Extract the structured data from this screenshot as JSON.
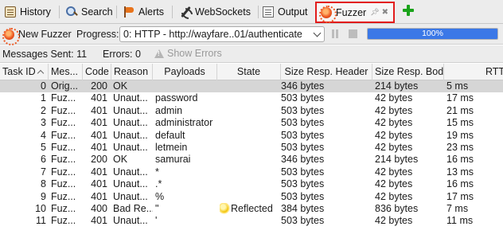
{
  "tabs": [
    {
      "label": "History",
      "icon": "history-icon"
    },
    {
      "label": "Search",
      "icon": "search-icon"
    },
    {
      "label": "Alerts",
      "icon": "alerts-flag-icon"
    },
    {
      "label": "WebSockets",
      "icon": "websockets-icon"
    },
    {
      "label": "Output",
      "icon": "output-icon"
    },
    {
      "label": "Fuzzer",
      "icon": "fuzzer-icon",
      "active": true
    }
  ],
  "toolbar": {
    "new_fuzzer_label": "New Fuzzer",
    "progress_label": "Progress:",
    "progress_select_value": "0: HTTP - http://wayfare..01/authenticate",
    "progress_percent_text": "100%",
    "progress_fraction": 1.0
  },
  "status": {
    "messages_sent": "Messages Sent: 11",
    "errors": "Errors: 0",
    "show_errors_label": "Show Errors"
  },
  "table": {
    "columns": [
      "Task ID",
      "Mes...",
      "Code",
      "Reason",
      "Payloads",
      "State",
      "Size Resp. Header",
      "Size Resp. Body",
      "RTT"
    ],
    "rows": [
      {
        "id": "0",
        "mes": "Orig...",
        "code": "200",
        "reason": "OK",
        "payload": "",
        "state": "",
        "hdr": "346 bytes",
        "body": "214 bytes",
        "rtt": "5 ms",
        "selected": true
      },
      {
        "id": "1",
        "mes": "Fuz...",
        "code": "401",
        "reason": "Unaut...",
        "payload": "password",
        "state": "",
        "hdr": "503 bytes",
        "body": "42 bytes",
        "rtt": "17 ms"
      },
      {
        "id": "2",
        "mes": "Fuz...",
        "code": "401",
        "reason": "Unaut...",
        "payload": "admin",
        "state": "",
        "hdr": "503 bytes",
        "body": "42 bytes",
        "rtt": "21 ms"
      },
      {
        "id": "3",
        "mes": "Fuz...",
        "code": "401",
        "reason": "Unaut...",
        "payload": "administrator",
        "state": "",
        "hdr": "503 bytes",
        "body": "42 bytes",
        "rtt": "15 ms"
      },
      {
        "id": "4",
        "mes": "Fuz...",
        "code": "401",
        "reason": "Unaut...",
        "payload": "default",
        "state": "",
        "hdr": "503 bytes",
        "body": "42 bytes",
        "rtt": "19 ms"
      },
      {
        "id": "5",
        "mes": "Fuz...",
        "code": "401",
        "reason": "Unaut...",
        "payload": "letmein",
        "state": "",
        "hdr": "503 bytes",
        "body": "42 bytes",
        "rtt": "23 ms"
      },
      {
        "id": "6",
        "mes": "Fuz...",
        "code": "200",
        "reason": "OK",
        "payload": "samurai",
        "state": "",
        "hdr": "346 bytes",
        "body": "214 bytes",
        "rtt": "16 ms"
      },
      {
        "id": "7",
        "mes": "Fuz...",
        "code": "401",
        "reason": "Unaut...",
        "payload": "*",
        "state": "",
        "hdr": "503 bytes",
        "body": "42 bytes",
        "rtt": "13 ms"
      },
      {
        "id": "8",
        "mes": "Fuz...",
        "code": "401",
        "reason": "Unaut...",
        "payload": ".*",
        "state": "",
        "hdr": "503 bytes",
        "body": "42 bytes",
        "rtt": "16 ms"
      },
      {
        "id": "9",
        "mes": "Fuz...",
        "code": "401",
        "reason": "Unaut...",
        "payload": "%",
        "state": "",
        "hdr": "503 bytes",
        "body": "42 bytes",
        "rtt": "17 ms"
      },
      {
        "id": "10",
        "mes": "Fuz...",
        "code": "400",
        "reason": "Bad Re...",
        "payload": "\"",
        "state": "Reflected",
        "hdr": "384 bytes",
        "body": "836 bytes",
        "rtt": "7 ms"
      },
      {
        "id": "11",
        "mes": "Fuz...",
        "code": "401",
        "reason": "Unaut...",
        "payload": "'",
        "state": "",
        "hdr": "503 bytes",
        "body": "42 bytes",
        "rtt": "11 ms"
      }
    ]
  }
}
